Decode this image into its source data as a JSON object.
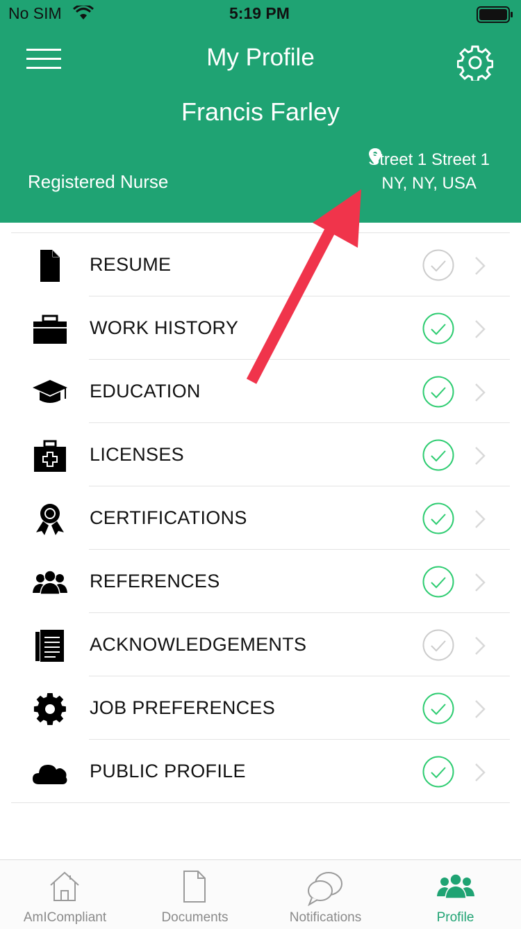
{
  "status_bar": {
    "carrier": "No SIM",
    "time": "5:19 PM"
  },
  "header": {
    "title": "My Profile",
    "name": "Francis Farley",
    "role": "Registered Nurse",
    "address_line1": "Street 1 Street 1",
    "address_line2": "NY, NY, USA",
    "background_color": "#1fa373"
  },
  "menu": [
    {
      "label": "RESUME",
      "icon": "document-icon",
      "status": "incomplete"
    },
    {
      "label": "WORK HISTORY",
      "icon": "briefcase-icon",
      "status": "complete"
    },
    {
      "label": "EDUCATION",
      "icon": "graduation-cap-icon",
      "status": "complete"
    },
    {
      "label": "LICENSES",
      "icon": "medical-kit-icon",
      "status": "complete"
    },
    {
      "label": "CERTIFICATIONS",
      "icon": "award-ribbon-icon",
      "status": "complete"
    },
    {
      "label": "REFERENCES",
      "icon": "people-icon",
      "status": "complete"
    },
    {
      "label": "ACKNOWLEDGEMENTS",
      "icon": "notes-icon",
      "status": "incomplete"
    },
    {
      "label": "JOB PREFERENCES",
      "icon": "gear-icon",
      "status": "complete"
    },
    {
      "label": "PUBLIC PROFILE",
      "icon": "cloud-icon",
      "status": "complete"
    }
  ],
  "tabs": [
    {
      "label": "AmICompliant",
      "icon": "home-icon"
    },
    {
      "label": "Documents",
      "icon": "file-icon"
    },
    {
      "label": "Notifications",
      "icon": "chat-icon"
    },
    {
      "label": "Profile",
      "icon": "people-icon",
      "active": true
    }
  ],
  "colors": {
    "accent": "#1fa373",
    "check_complete": "#2ecc71",
    "check_incomplete": "#cccccc",
    "annotation_arrow": "#f0344b"
  }
}
